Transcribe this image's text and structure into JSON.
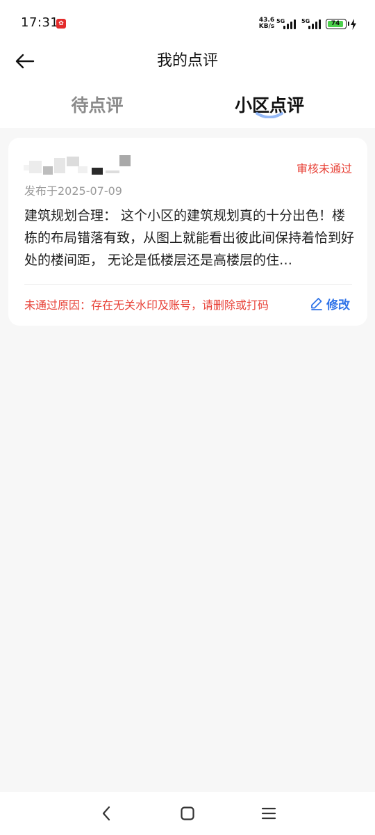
{
  "status_bar": {
    "time": "17:31",
    "net_speed_value": "43.6",
    "net_speed_unit": "KB/s",
    "sim1": "5G",
    "sim2": "5G",
    "battery": "74"
  },
  "header": {
    "title": "我的点评",
    "back_icon": "arrow-left-icon"
  },
  "tabs": [
    {
      "label": "待点评",
      "active": false
    },
    {
      "label": "小区点评",
      "active": true
    }
  ],
  "review": {
    "status": "审核未通过",
    "date": "发布于2025-07-09",
    "content": "建筑规划合理： 这个小区的建筑规划真的十分出色！楼栋的布局错落有致，从图上就能看出彼此间保持着恰到好处的楼间距， 无论是低楼层还是高楼层的住…",
    "reject_reason": "未通过原因：存在无关水印及账号，请删除或打码",
    "edit_label": "修改"
  },
  "colors": {
    "error": "#e8443a",
    "link": "#2f73e8",
    "battery": "#4cd04c"
  }
}
